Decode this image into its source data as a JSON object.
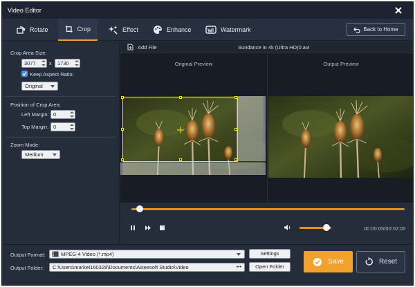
{
  "window": {
    "title": "Video Editor"
  },
  "tabs": [
    {
      "label": "Rotate",
      "icon": "rotate-icon",
      "active": false
    },
    {
      "label": "Crop",
      "icon": "crop-icon",
      "active": true
    },
    {
      "label": "Effect",
      "icon": "effect-icon",
      "active": false
    },
    {
      "label": "Enhance",
      "icon": "palette-icon",
      "active": false
    },
    {
      "label": "Watermark",
      "icon": "watermark-icon",
      "active": false
    }
  ],
  "back_home_label": "Back to Home",
  "crop": {
    "area_size_label": "Crop Area Size:",
    "width": "3077",
    "height": "1730",
    "x_separator": "x",
    "keep_aspect_label": "Keep Aspect Ratio:",
    "keep_aspect_checked": true,
    "aspect_value": "Original",
    "position_label": "Position of Crop Area:",
    "left_margin_label": "Left Margin:",
    "left_margin_value": "0",
    "top_margin_label": "Top Margin:",
    "top_margin_value": "0",
    "zoom_mode_label": "Zoom Mode:",
    "zoom_mode_value": "Medium"
  },
  "preview": {
    "add_file_label": "Add File",
    "file_name": "Sundance in 4k (Ultra HD)0.avi",
    "original_title": "Original Preview",
    "output_title": "Output Preview"
  },
  "player": {
    "seek_fraction": 0.03,
    "volume_fraction": 0.85,
    "time": "00:00:05/00:02:00"
  },
  "output": {
    "format_label": "Output Format:",
    "format_value": "MPEG-4 Video (*.mp4)",
    "settings_label": "Settings",
    "folder_label": "Output Folder:",
    "folder_value": "C:\\Users\\market160328\\Documents\\Aiseesoft Studio\\Video",
    "folder_dots": "•••",
    "open_folder_label": "Open Folder"
  },
  "actions": {
    "save_label": "Save",
    "reset_label": "Reset"
  },
  "colors": {
    "accent": "#f2a12b",
    "crop_frame": "#f0e60c",
    "checkbox": "#4b8df0"
  }
}
